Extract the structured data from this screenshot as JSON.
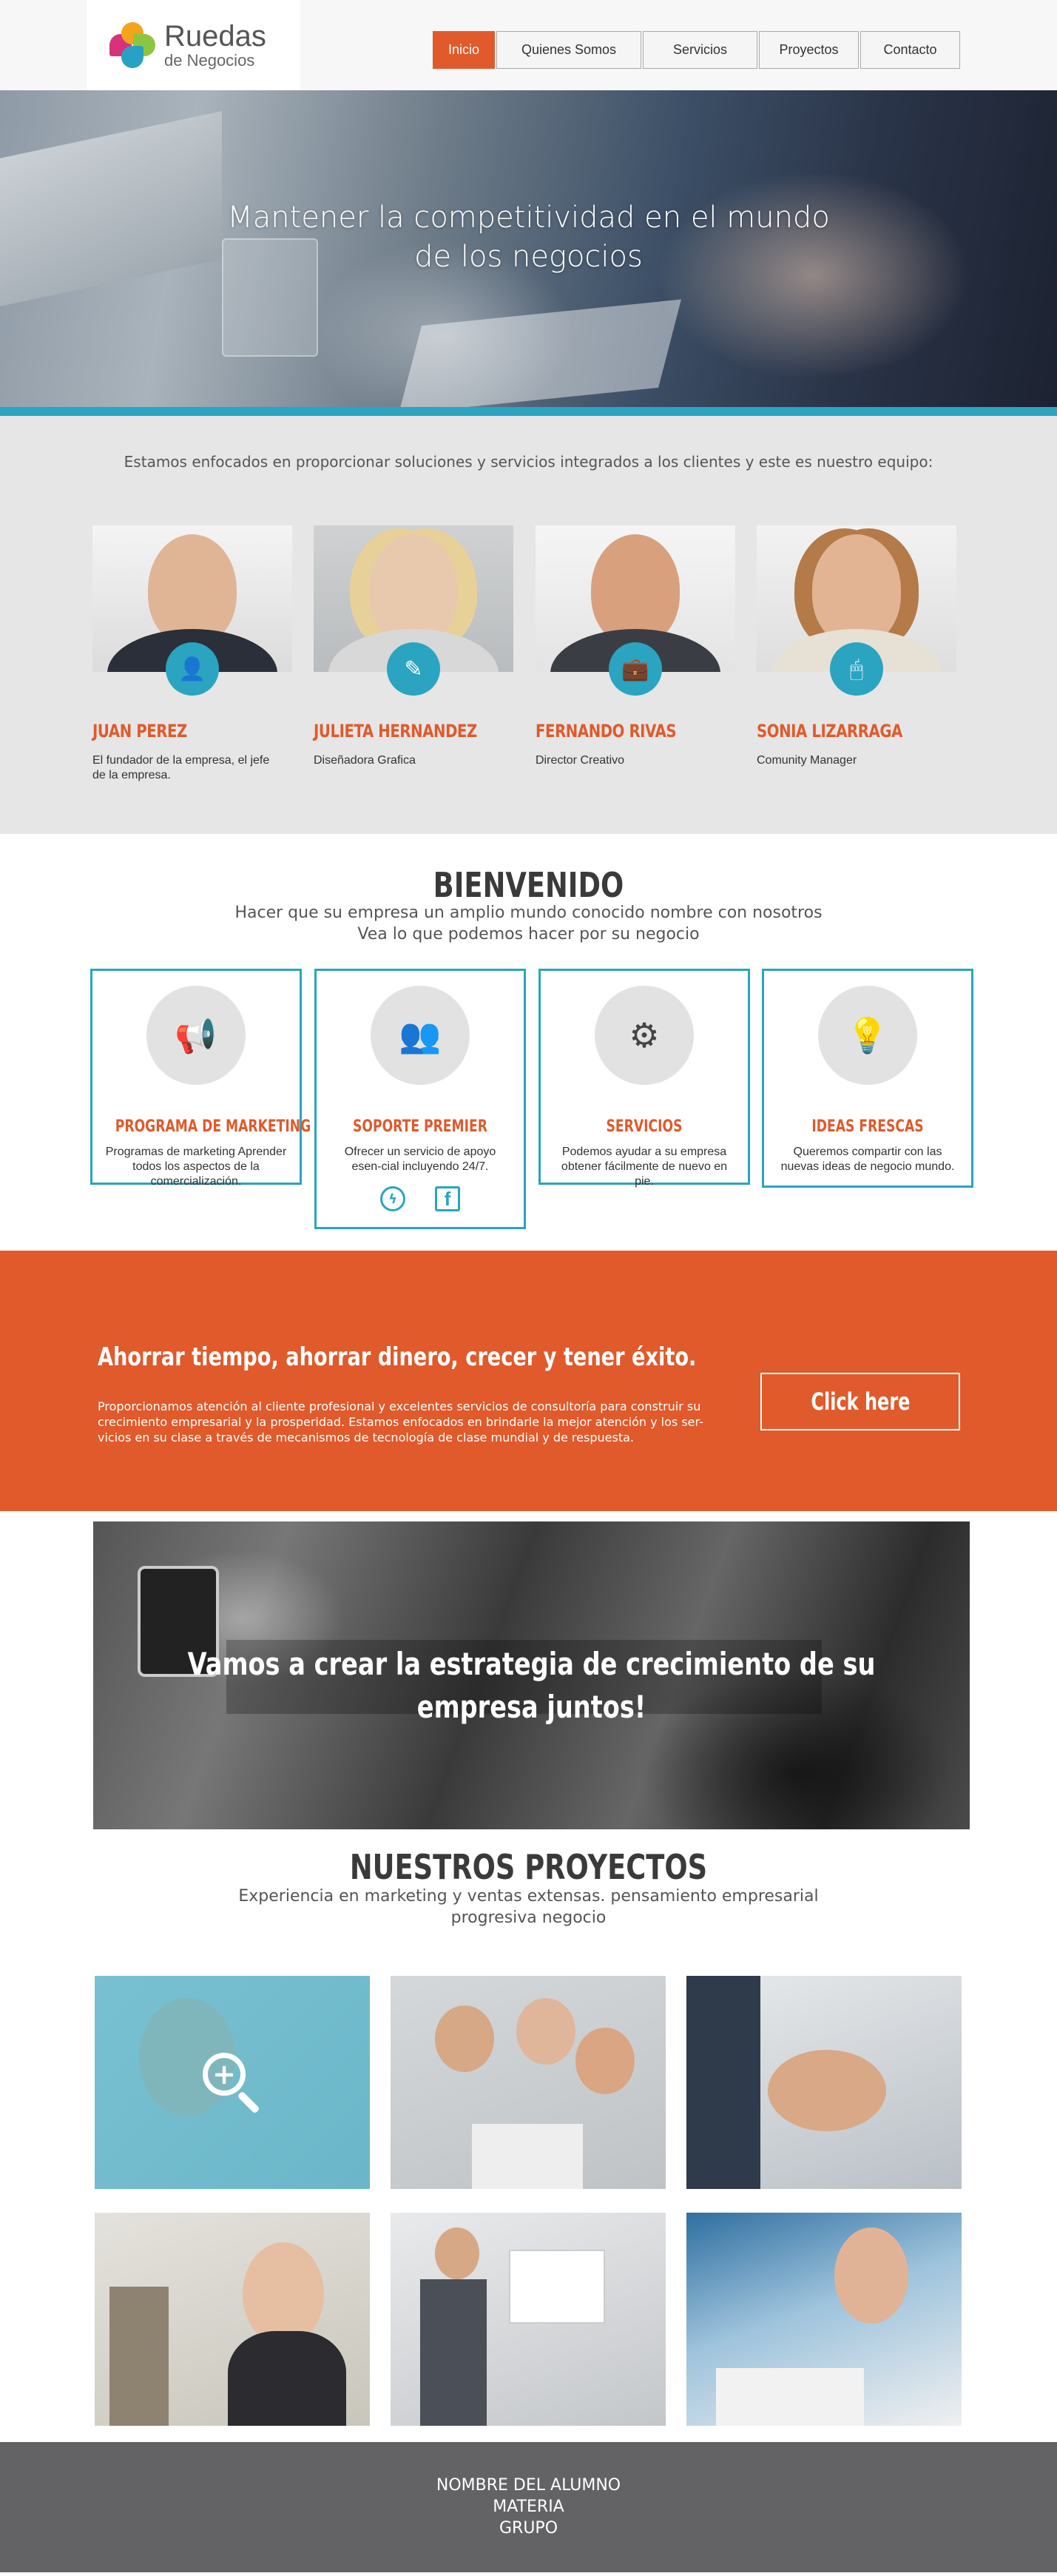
{
  "header": {
    "logo_title": "Ruedas",
    "logo_subtitle": "de Negocios",
    "nav": [
      {
        "label": "Inicio",
        "active": true
      },
      {
        "label": "Quienes Somos",
        "active": false
      },
      {
        "label": "Servicios",
        "active": false
      },
      {
        "label": "Proyectos",
        "active": false
      },
      {
        "label": "Contacto",
        "active": false
      }
    ]
  },
  "hero": {
    "title_line1": "Mantener la competitividad en el mundo",
    "title_line2": "de los negocios"
  },
  "team": {
    "intro": "Estamos enfocados en proporcionar soluciones y servicios integrados a los clientes y este es nuestro equipo:",
    "members": [
      {
        "name": "JUAN PEREZ",
        "role": "El fundador de la empresa, el jefe de la empresa.",
        "icon": "person-icon"
      },
      {
        "name": "JULIETA HERNANDEZ",
        "role": "Diseñadora Grafica",
        "icon": "pen-icon"
      },
      {
        "name": "FERNANDO RIVAS",
        "role": "Director Creativo",
        "icon": "briefcase-icon"
      },
      {
        "name": "SONIA LIZARRAGA",
        "role": "Comunity Manager",
        "icon": "mouse-icon"
      }
    ]
  },
  "welcome": {
    "title": "BIENVENIDO",
    "subtitle_line1": "Hacer que su empresa un amplio mundo conocido nombre con nosotros",
    "subtitle_line2": "Vea lo que podemos hacer por su negocio",
    "services": [
      {
        "title": "PROGRAMA DE MARKETING",
        "desc": "Programas de marketing Aprender todos los aspectos de la comercialización.",
        "icon": "megaphone-icon"
      },
      {
        "title": "SOPORTE PREMIER",
        "desc": "Ofrecer un servicio de apoyo esen-cial incluyendo 24/7.",
        "icon": "group-icon"
      },
      {
        "title": "SERVICIOS",
        "desc": "Podemos ayudar a su empresa obtener fácilmente de nuevo en pie.",
        "icon": "gears-icon"
      },
      {
        "title": "IDEAS FRESCAS",
        "desc": "Queremos compartir con las nuevas ideas de negocio mundo.",
        "icon": "lightbulb-icon"
      }
    ]
  },
  "cta": {
    "title": "Ahorrar tiempo, ahorrar dinero, crecer y tener éxito.",
    "text": "Proporcionamos atención al cliente profesional y excelentes servicios de consultoría para construir su crecimiento empresarial y la prosperidad. Estamos enfocados en brindarle la mejor atención y los ser-vicios en su clase a través de mecanismos de tecnología de clase mundial y de respuesta.",
    "button": "Click here"
  },
  "strategy": {
    "title_line1": "Vamos a crear la estrategia de crecimiento de su",
    "title_line2": "empresa juntos!"
  },
  "projects": {
    "title": "NUESTROS PROYECTOS",
    "subtitle_line1": "Experiencia en marketing y ventas extensas. pensamiento empresarial",
    "subtitle_line2": "progresiva negocio"
  },
  "footer": {
    "line1": "NOMBRE DEL ALUMNO",
    "line2": "MATERIA",
    "line3": "GRUPO"
  },
  "colors": {
    "accent_orange": "#e05a2b",
    "accent_teal": "#2aa4c0",
    "footer_gray": "#636366"
  }
}
